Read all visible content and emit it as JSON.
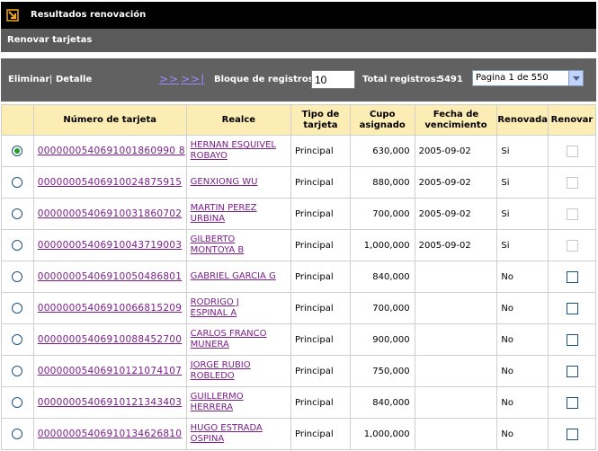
{
  "header": {
    "title": "Resultados renovación"
  },
  "subheader": {
    "title": "Renovar tarjetas"
  },
  "toolbar": {
    "eliminar": "Eliminar",
    "separator": "|",
    "detalle": "Detalle",
    "next_label": ">>",
    "last_label": ">>|",
    "block_label": "Bloque de registros:",
    "block_value": "10",
    "total_label": "Total registros:",
    "total_value": "5491",
    "page_select": "Pagina 1 de 550"
  },
  "table": {
    "columns": [
      "",
      "Número de tarjeta",
      "Realce",
      "Tipo de tarjeta",
      "Cupo asignado",
      "Fecha de vencimiento",
      "Renovada",
      "Renovar"
    ],
    "rows": [
      {
        "selected": true,
        "numero": "0000000540691001860990 8",
        "realce": [
          "HERNAN ESQUIVEL",
          "ROBAYO"
        ],
        "tipo": "Principal",
        "cupo": "630,000",
        "fecha": "2005-09-02",
        "renovada": "Si",
        "renovar_enabled": false
      },
      {
        "selected": false,
        "numero": "00000005406910024875915",
        "realce": [
          "GENXIONG WU"
        ],
        "tipo": "Principal",
        "cupo": "880,000",
        "fecha": "2005-09-02",
        "renovada": "Si",
        "renovar_enabled": false
      },
      {
        "selected": false,
        "numero": "00000005406910031860702",
        "realce": [
          "MARTIN PEREZ",
          "URBINA"
        ],
        "tipo": "Principal",
        "cupo": "700,000",
        "fecha": "2005-09-02",
        "renovada": "Si",
        "renovar_enabled": false
      },
      {
        "selected": false,
        "numero": "00000005406910043719003",
        "realce": [
          "GILBERTO",
          "MONTOYA B"
        ],
        "tipo": "Principal",
        "cupo": "1,000,000",
        "fecha": "2005-09-02",
        "renovada": "Si",
        "renovar_enabled": false
      },
      {
        "selected": false,
        "numero": "00000005406910050486801",
        "realce": [
          "GABRIEL GARCIA G"
        ],
        "tipo": "Principal",
        "cupo": "840,000",
        "fecha": "",
        "renovada": "No",
        "renovar_enabled": true
      },
      {
        "selected": false,
        "numero": "00000005406910066815209",
        "realce": [
          "RODRIGO J",
          "ESPINAL A"
        ],
        "tipo": "Principal",
        "cupo": "700,000",
        "fecha": "",
        "renovada": "No",
        "renovar_enabled": true
      },
      {
        "selected": false,
        "numero": "00000005406910088452700",
        "realce": [
          "CARLOS FRANCO",
          "MUNERA"
        ],
        "tipo": "Principal",
        "cupo": "900,000",
        "fecha": "",
        "renovada": "No",
        "renovar_enabled": true
      },
      {
        "selected": false,
        "numero": "00000005406910121074107",
        "realce": [
          "JORGE RUBIO",
          "ROBLEDO"
        ],
        "tipo": "Principal",
        "cupo": "750,000",
        "fecha": "",
        "renovada": "No",
        "renovar_enabled": true
      },
      {
        "selected": false,
        "numero": "00000005406910121343403",
        "realce": [
          "GUILLERMO",
          "HERRERA"
        ],
        "tipo": "Principal",
        "cupo": "840,000",
        "fecha": "",
        "renovada": "No",
        "renovar_enabled": true
      },
      {
        "selected": false,
        "numero": "00000005406910134626810",
        "realce": [
          "HUGO ESTRADA",
          "OSPINA"
        ],
        "tipo": "Principal",
        "cupo": "1,000,000",
        "fecha": "",
        "renovada": "No",
        "renovar_enabled": true
      }
    ]
  }
}
